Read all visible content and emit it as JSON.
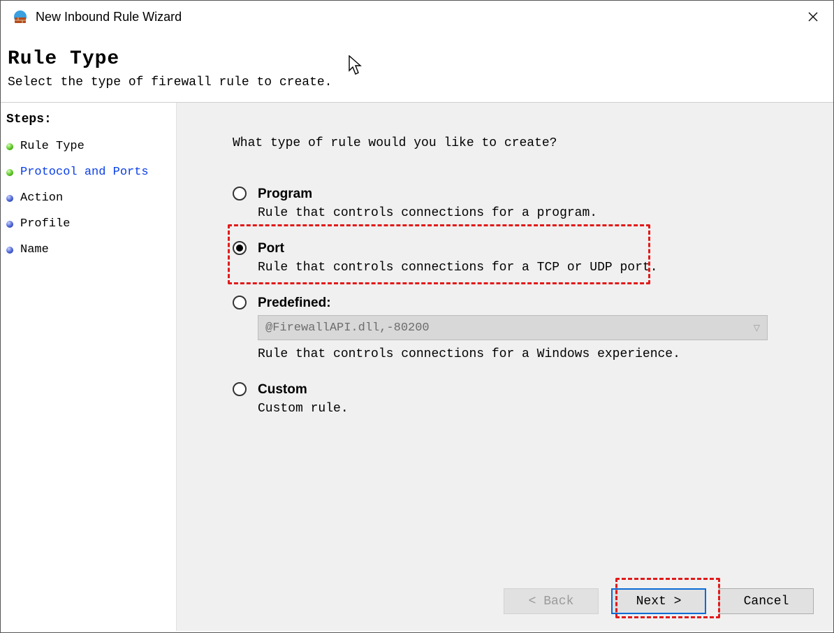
{
  "window": {
    "title": "New Inbound Rule Wizard"
  },
  "header": {
    "heading": "Rule Type",
    "subtitle": "Select the type of firewall rule to create."
  },
  "sidebar": {
    "title": "Steps:",
    "steps": [
      {
        "label": "Rule Type",
        "bullet": "green",
        "active": false
      },
      {
        "label": "Protocol and Ports",
        "bullet": "green",
        "active": true
      },
      {
        "label": "Action",
        "bullet": "blue",
        "active": false
      },
      {
        "label": "Profile",
        "bullet": "blue",
        "active": false
      },
      {
        "label": "Name",
        "bullet": "blue",
        "active": false
      }
    ]
  },
  "main": {
    "prompt": "What type of rule would you like to create?",
    "options": {
      "program": {
        "title": "Program",
        "desc": "Rule that controls connections for a program.",
        "selected": false
      },
      "port": {
        "title": "Port",
        "desc": "Rule that controls connections for a TCP or UDP port.",
        "selected": true
      },
      "predefined": {
        "title": "Predefined:",
        "combo_value": "@FirewallAPI.dll,-80200",
        "desc": "Rule that controls connections for a Windows experience.",
        "selected": false
      },
      "custom": {
        "title": "Custom",
        "desc": "Custom rule.",
        "selected": false
      }
    }
  },
  "footer": {
    "back": "< Back",
    "next": "Next >",
    "cancel": "Cancel"
  }
}
